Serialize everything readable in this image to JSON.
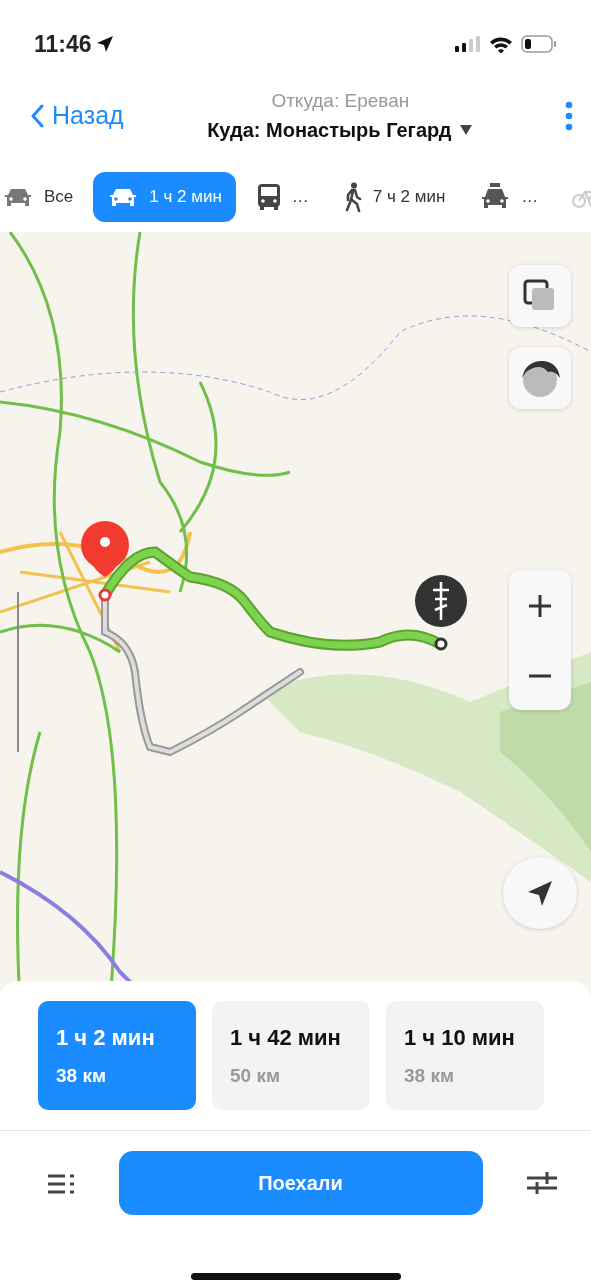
{
  "status_bar": {
    "time": "11:46"
  },
  "header": {
    "back": "Назад",
    "from": "Откуда: Ереван",
    "to": "Куда: Монастырь Гегард"
  },
  "modes": [
    {
      "kind": "all",
      "label": "Все",
      "selected": false
    },
    {
      "kind": "car",
      "label": "1 ч 2 мин",
      "selected": true
    },
    {
      "kind": "bus",
      "label": "…",
      "selected": false
    },
    {
      "kind": "walk",
      "label": "7 ч 2 мин",
      "selected": false
    },
    {
      "kind": "taxi",
      "label": "…",
      "selected": false
    },
    {
      "kind": "bike",
      "selected": false
    }
  ],
  "routes": [
    {
      "time": "1 ч 2 мин",
      "distance": "38 км",
      "selected": true
    },
    {
      "time": "1 ч 42 мин",
      "distance": "50 км",
      "selected": false
    },
    {
      "time": "1 ч 10 мин",
      "distance": "38 км",
      "selected": false
    }
  ],
  "go_button": "Поехали"
}
